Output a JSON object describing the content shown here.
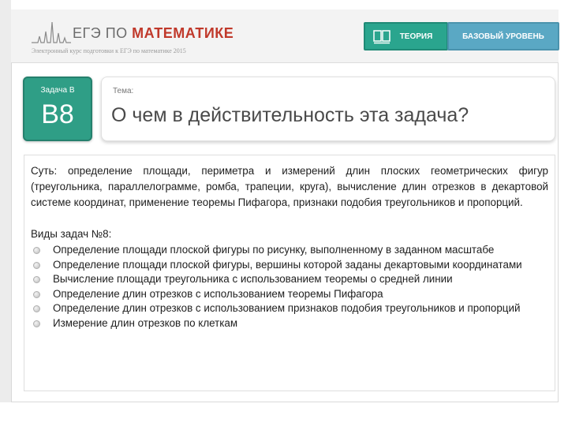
{
  "header": {
    "logo_text": "ЕГЭ ПО",
    "logo_accent": "МАТЕМАТИКЕ",
    "logo_subtitle": "Электронный курс подготовки к ЕГЭ по математике 2015",
    "theory_button": "ТЕОРИЯ",
    "level_button": "БАЗОВЫЙ УРОВЕНЬ"
  },
  "task": {
    "label": "Задача В",
    "number": "B8"
  },
  "topic": {
    "label": "Тема:",
    "title": "О чем в действительность эта задача?"
  },
  "content": {
    "summary": "Суть: определение площади, периметра и измерений длин плоских геометрических фигур (треугольника, параллелограмме, ромба, трапеции, круга), вычисление длин отрезков в декартовой системе координат, применение теоремы Пифагора, признаки подобия треугольников и пропорций.",
    "types_heading": "Виды задач №8:",
    "types": [
      "Определение площади плоской фигуры по рисунку, выполненному в заданном масштабе",
      "Определение площади плоской фигуры, вершины которой заданы декартовыми координатами",
      "Вычисление площади треугольника с использованием теоремы о средней линии",
      "Определение длин отрезков с использованием теоремы Пифагора",
      "Определение длин отрезков с использованием признаков подобия треугольников и пропорций",
      "Измерение длин отрезков по клеткам"
    ]
  },
  "colors": {
    "teal": "#2aa58e",
    "blue": "#5aa8c4",
    "logo_red": "#c0392b"
  }
}
